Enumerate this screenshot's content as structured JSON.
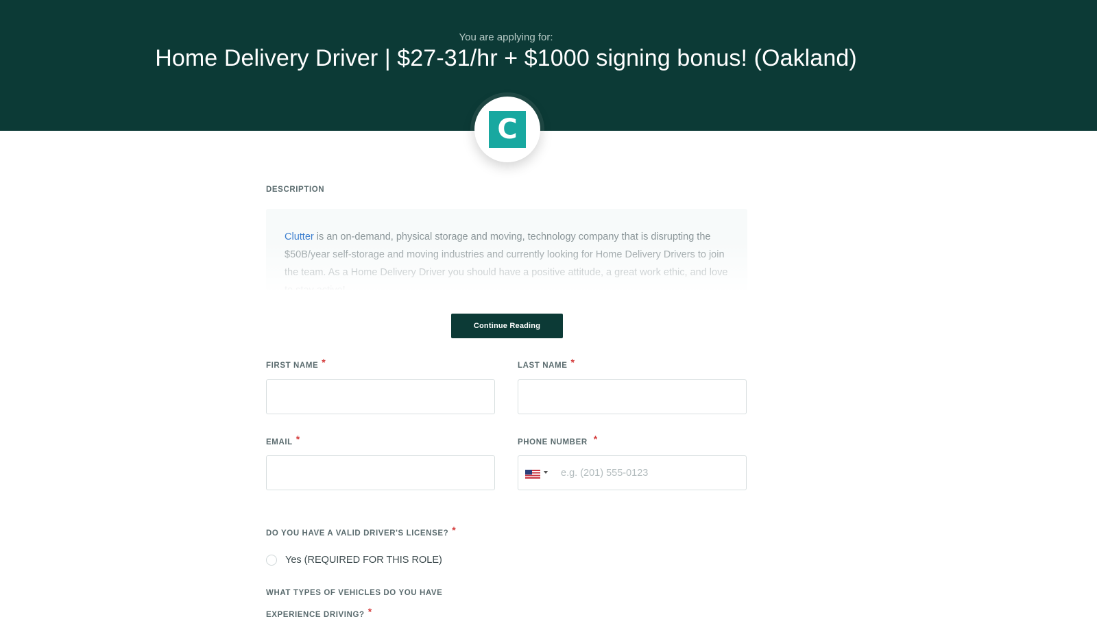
{
  "header": {
    "pre_title": "You are applying for:",
    "job_title": "Home Delivery Driver | $27-31/hr + $1000 signing bonus! (Oakland)",
    "background_color": "#0c3a36"
  },
  "logo": {
    "letter": "C",
    "icon": "company-logo",
    "color": "#18a8a0"
  },
  "description": {
    "label": "DESCRIPTION",
    "company_link": "Clutter",
    "text": " is an on-demand, physical storage and moving, technology company that is disrupting the $50B/year self-storage and moving industries and currently looking for Home Delivery Drivers to join the team. As a Home Delivery Driver you should have a positive attitude, a great work ethic, and love to stay active!",
    "continue_label": "Continue Reading"
  },
  "form": {
    "required_marker": "*",
    "first_name": {
      "label": "FIRST NAME",
      "value": ""
    },
    "last_name": {
      "label": "LAST NAME",
      "value": ""
    },
    "email": {
      "label": "EMAIL",
      "value": ""
    },
    "phone": {
      "label": "PHONE NUMBER",
      "placeholder": "e.g. (201) 555-0123",
      "country_icon": "us-flag-icon",
      "value": ""
    },
    "license_question": {
      "label": "DO YOU HAVE A VALID DRIVER'S LICENSE?",
      "option_yes": "Yes (REQUIRED FOR THIS ROLE)"
    },
    "vehicles_question": {
      "label_line1": "WHAT TYPES OF VEHICLES DO YOU HAVE",
      "label_line2": "EXPERIENCE DRIVING?"
    }
  }
}
